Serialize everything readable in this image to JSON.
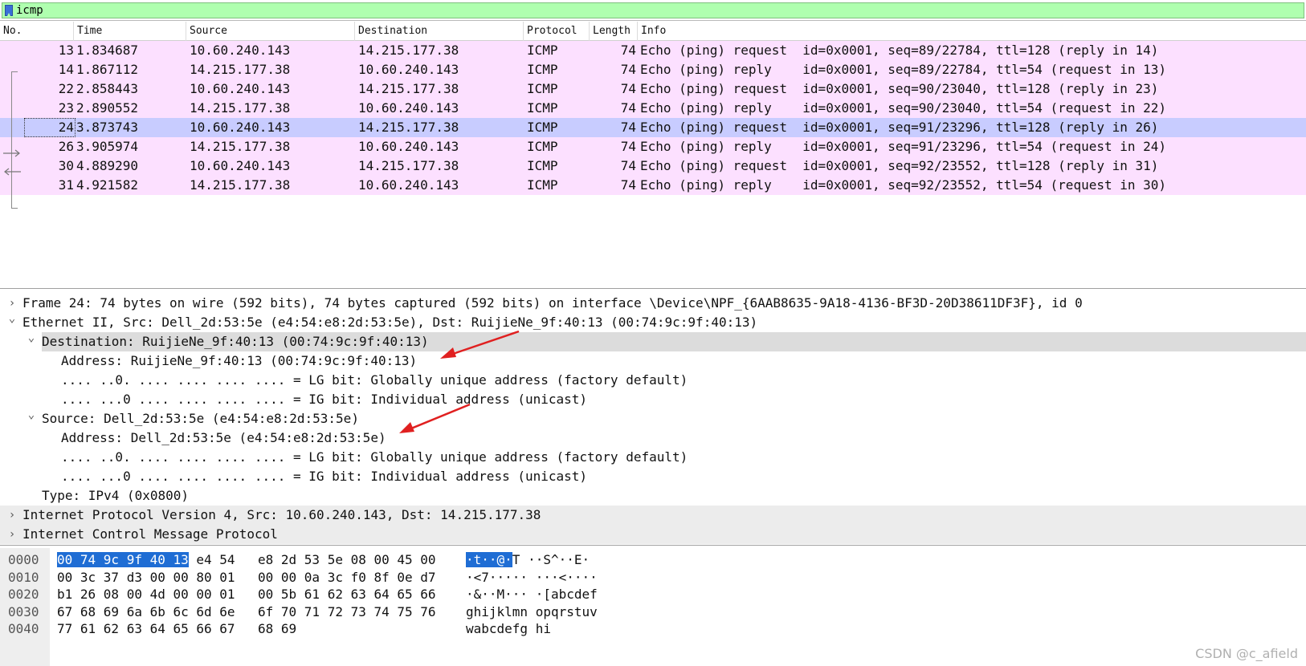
{
  "filter": {
    "text": "icmp"
  },
  "packet_list": {
    "columns": [
      "No.",
      "Time",
      "Source",
      "Destination",
      "Protocol",
      "Length",
      "Info"
    ],
    "rows": [
      {
        "no": "13",
        "time": "1.834687",
        "src": "10.60.240.143",
        "dst": "14.215.177.38",
        "proto": "ICMP",
        "len": "74",
        "info": "Echo (ping) request  id=0x0001, seq=89/22784, ttl=128 (reply in 14)"
      },
      {
        "no": "14",
        "time": "1.867112",
        "src": "14.215.177.38",
        "dst": "10.60.240.143",
        "proto": "ICMP",
        "len": "74",
        "info": "Echo (ping) reply    id=0x0001, seq=89/22784, ttl=54 (request in 13)"
      },
      {
        "no": "22",
        "time": "2.858443",
        "src": "10.60.240.143",
        "dst": "14.215.177.38",
        "proto": "ICMP",
        "len": "74",
        "info": "Echo (ping) request  id=0x0001, seq=90/23040, ttl=128 (reply in 23)"
      },
      {
        "no": "23",
        "time": "2.890552",
        "src": "14.215.177.38",
        "dst": "10.60.240.143",
        "proto": "ICMP",
        "len": "74",
        "info": "Echo (ping) reply    id=0x0001, seq=90/23040, ttl=54 (request in 22)"
      },
      {
        "no": "24",
        "time": "3.873743",
        "src": "10.60.240.143",
        "dst": "14.215.177.38",
        "proto": "ICMP",
        "len": "74",
        "info": "Echo (ping) request  id=0x0001, seq=91/23296, ttl=128 (reply in 26)"
      },
      {
        "no": "26",
        "time": "3.905974",
        "src": "14.215.177.38",
        "dst": "10.60.240.143",
        "proto": "ICMP",
        "len": "74",
        "info": "Echo (ping) reply    id=0x0001, seq=91/23296, ttl=54 (request in 24)"
      },
      {
        "no": "30",
        "time": "4.889290",
        "src": "10.60.240.143",
        "dst": "14.215.177.38",
        "proto": "ICMP",
        "len": "74",
        "info": "Echo (ping) request  id=0x0001, seq=92/23552, ttl=128 (reply in 31)"
      },
      {
        "no": "31",
        "time": "4.921582",
        "src": "14.215.177.38",
        "dst": "10.60.240.143",
        "proto": "ICMP",
        "len": "74",
        "info": "Echo (ping) reply    id=0x0001, seq=92/23552, ttl=54 (request in 30)"
      }
    ],
    "selected_no": "24"
  },
  "details": [
    {
      "chev": ">",
      "indent": 0,
      "shade": false,
      "text": "Frame 24: 74 bytes on wire (592 bits), 74 bytes captured (592 bits) on interface \\Device\\NPF_{6AAB8635-9A18-4136-BF3D-20D38611DF3F}, id 0"
    },
    {
      "chev": "v",
      "indent": 0,
      "shade": false,
      "text": "Ethernet II, Src: Dell_2d:53:5e (e4:54:e8:2d:53:5e), Dst: RuijieNe_9f:40:13 (00:74:9c:9f:40:13)"
    },
    {
      "chev": "v",
      "indent": 1,
      "shade": true,
      "text": "Destination: RuijieNe_9f:40:13 (00:74:9c:9f:40:13)"
    },
    {
      "chev": "",
      "indent": 2,
      "shade": false,
      "text": "Address: RuijieNe_9f:40:13 (00:74:9c:9f:40:13)"
    },
    {
      "chev": "",
      "indent": 2,
      "shade": false,
      "text": ".... ..0. .... .... .... .... = LG bit: Globally unique address (factory default)"
    },
    {
      "chev": "",
      "indent": 2,
      "shade": false,
      "text": ".... ...0 .... .... .... .... = IG bit: Individual address (unicast)"
    },
    {
      "chev": "v",
      "indent": 1,
      "shade": false,
      "text": "Source: Dell_2d:53:5e (e4:54:e8:2d:53:5e)"
    },
    {
      "chev": "",
      "indent": 2,
      "shade": false,
      "text": "Address: Dell_2d:53:5e (e4:54:e8:2d:53:5e)"
    },
    {
      "chev": "",
      "indent": 2,
      "shade": false,
      "text": ".... ..0. .... .... .... .... = LG bit: Globally unique address (factory default)"
    },
    {
      "chev": "",
      "indent": 2,
      "shade": false,
      "text": ".... ...0 .... .... .... .... = IG bit: Individual address (unicast)"
    },
    {
      "chev": "",
      "indent": 1,
      "shade": false,
      "text": "Type: IPv4 (0x0800)"
    },
    {
      "chev": ">",
      "indent": 0,
      "shade": true,
      "text": "Internet Protocol Version 4, Src: 10.60.240.143, Dst: 14.215.177.38"
    },
    {
      "chev": ">",
      "indent": 0,
      "shade": true,
      "text": "Internet Control Message Protocol"
    }
  ],
  "hex": [
    {
      "off": "0000",
      "hl": "00 74 9c 9f 40 13",
      "a": " e4 54",
      "b": "e8 2d 53 5e 08 00 45 00",
      "asc_hl": "·t··@·",
      "asc": "T ··S^··E·"
    },
    {
      "off": "0010",
      "hl": "",
      "a": "00 3c 37 d3 00 00 80 01",
      "b": "00 00 0a 3c f0 8f 0e d7",
      "asc_hl": "",
      "asc": "·<7····· ···<····"
    },
    {
      "off": "0020",
      "hl": "",
      "a": "b1 26 08 00 4d 00 00 01",
      "b": "00 5b 61 62 63 64 65 66",
      "asc_hl": "",
      "asc": "·&··M··· ·[abcdef"
    },
    {
      "off": "0030",
      "hl": "",
      "a": "67 68 69 6a 6b 6c 6d 6e",
      "b": "6f 70 71 72 73 74 75 76",
      "asc_hl": "",
      "asc": "ghijklmn opqrstuv"
    },
    {
      "off": "0040",
      "hl": "",
      "a": "77 61 62 63 64 65 66 67",
      "b": "68 69",
      "asc_hl": "",
      "asc": "wabcdefg hi"
    }
  ],
  "watermark": "CSDN @c_afield",
  "colors": {
    "filter_bg": "#afffaf",
    "row_bg": "#fce0ff",
    "row_selected_bg": "#c8ccff",
    "hex_highlight": "#1f6dd4",
    "annotation_arrow": "#e02020"
  }
}
